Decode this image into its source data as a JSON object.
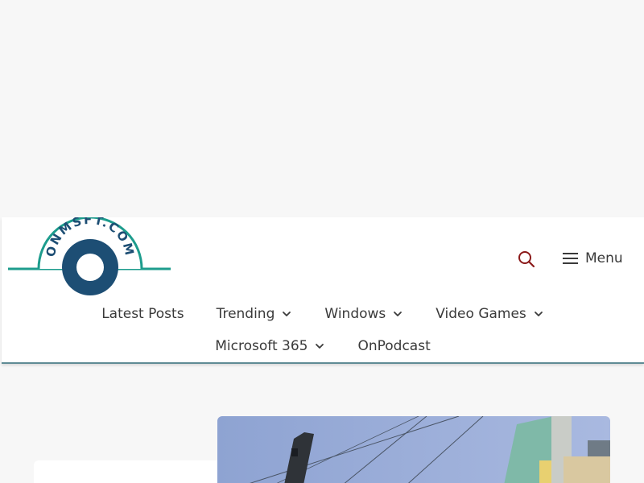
{
  "header": {
    "logo_text": "ONMSFT.COM",
    "menu_label": "Menu"
  },
  "nav": {
    "row1": [
      {
        "label": "Latest Posts",
        "has_dropdown": false
      },
      {
        "label": "Trending",
        "has_dropdown": true
      },
      {
        "label": "Windows",
        "has_dropdown": true
      },
      {
        "label": "Video Games",
        "has_dropdown": true
      }
    ],
    "row2": [
      {
        "label": "Microsoft 365",
        "has_dropdown": true
      },
      {
        "label": "OnPodcast",
        "has_dropdown": false
      }
    ]
  },
  "icons": {
    "search": "search-icon",
    "menu": "hamburger-icon",
    "dropdown": "chevron-down-icon"
  },
  "colors": {
    "logo_teal": "#1d9c8d",
    "logo_navy": "#1d4e74",
    "search_icon": "#8b1a1a",
    "header_border": "#5f8c95",
    "nav_text": "#3a3a3a"
  }
}
